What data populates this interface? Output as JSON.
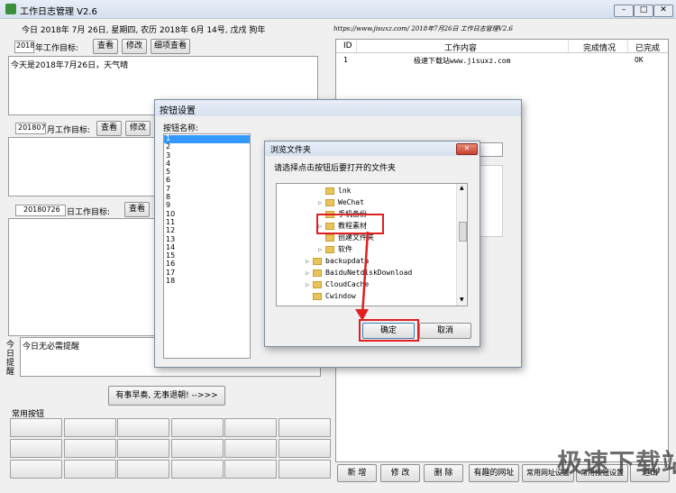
{
  "app": {
    "title": "工作日志管理 V2.6",
    "date_line": "今日 2018年 7月 26日, 星期四, 农历 2018年 6月 14号, 戊戌 狗年",
    "header_banner": "https://www.jisuxz.com/ 2018年7月26日 工作日志管理V2.6",
    "window_controls": [
      "min",
      "max",
      "close"
    ]
  },
  "year_section": {
    "year_value": "2018",
    "label": "年工作目标:",
    "btn_view": "查看",
    "btn_edit": "修改",
    "btn_detail": "细项查看",
    "text": "今天是2018年7月26日，天气晴"
  },
  "month_section": {
    "month_value": "201807",
    "label": "月工作目标:",
    "btn_view": "查看",
    "btn_edit": "修改"
  },
  "day_section": {
    "day_value": "20180726",
    "label": "日工作目标:",
    "btn_view": "查看"
  },
  "reminder": {
    "side_label": "今日提醒",
    "text": "今日无必需提醒"
  },
  "motto_button": "有事早奏, 无事退朝! -->>>",
  "common_buttons_title": "常用按钮",
  "table": {
    "headers": [
      "ID",
      "工作内容",
      "完成情况",
      "已完成"
    ],
    "rows": [
      {
        "id": "1",
        "content": "极速下载站www.jisuxz.com",
        "status": "",
        "done": "OK"
      }
    ]
  },
  "bottom_buttons": [
    "新 增",
    "修 改",
    "删 除",
    "有趣的网址",
    "常用网址设置",
    "常用按钮设置",
    "退出"
  ],
  "button_settings": {
    "title": "按钮设置",
    "list_label": "按钮名称:",
    "items": [
      "1",
      "2",
      "3",
      "4",
      "5",
      "6",
      "7",
      "8",
      "9",
      "10",
      "11",
      "12",
      "13",
      "14",
      "15",
      "16",
      "17",
      "18"
    ]
  },
  "browse_dialog": {
    "title": "浏览文件夹",
    "prompt": "请选择点击按钮后要打开的文件夹",
    "tree": [
      {
        "name": "lnk",
        "indent": 2,
        "arrow": ""
      },
      {
        "name": "WeChat",
        "indent": 2,
        "arrow": "▷"
      },
      {
        "name": "手机备份",
        "indent": 2,
        "arrow": ""
      },
      {
        "name": "教程素材",
        "indent": 2,
        "arrow": "▷"
      },
      {
        "name": "创建文件夹",
        "indent": 2,
        "arrow": ""
      },
      {
        "name": "软件",
        "indent": 2,
        "arrow": "▷"
      },
      {
        "name": "backupdata",
        "indent": 1,
        "arrow": "▷"
      },
      {
        "name": "BaiduNetdiskDownload",
        "indent": 1,
        "arrow": "▷"
      },
      {
        "name": "CloudCache",
        "indent": 1,
        "arrow": "▷"
      },
      {
        "name": "Cwindow",
        "indent": 1,
        "arrow": ""
      }
    ],
    "ok": "确定",
    "cancel": "取消"
  },
  "watermark": "极速下载站"
}
